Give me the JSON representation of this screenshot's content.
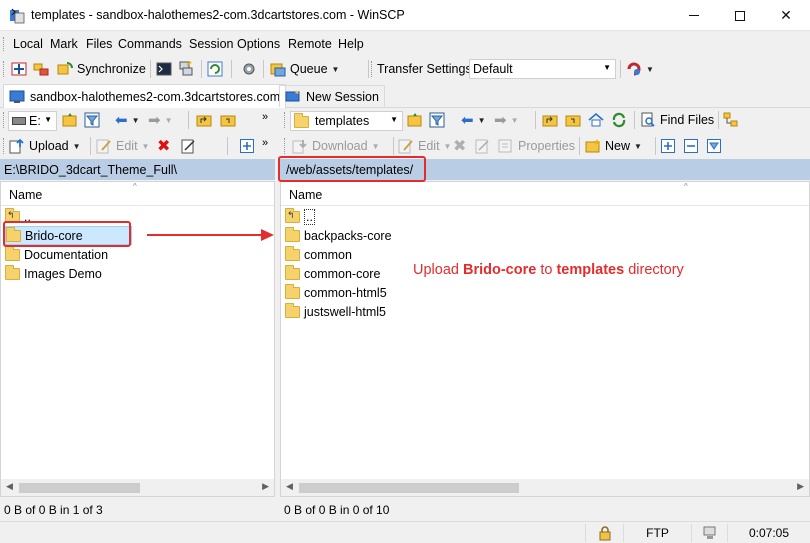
{
  "window": {
    "title": "templates - sandbox-halothemes2-com.3dcartstores.com - WinSCP"
  },
  "menu": [
    "Local",
    "Mark",
    "Files",
    "Commands",
    "Session",
    "Options",
    "Remote",
    "Help"
  ],
  "toolbar": {
    "synchronize_label": "Synchronize",
    "queue_label": "Queue",
    "transfer_settings_label": "Transfer Settings",
    "transfer_settings_value": "Default"
  },
  "tabs": {
    "session_label": "sandbox-halothemes2-com.3dcartstores.com",
    "new_session_label": "New Session"
  },
  "left": {
    "drive": "E:",
    "path": "E:\\BRIDO_3dcart_Theme_Full\\",
    "upload_label": "Upload",
    "edit_label": "Edit",
    "column_name": "Name",
    "parent": "..",
    "items": [
      "Brido-core",
      "Documentation",
      "Images Demo"
    ],
    "status": "0 B of 0 B in 1 of 3"
  },
  "right": {
    "folder": "templates",
    "path": "/web/assets/templates/",
    "find_files_label": "Find Files",
    "download_label": "Download",
    "edit_label": "Edit",
    "properties_label": "Properties",
    "new_label": "New",
    "column_name": "Name",
    "parent": "..",
    "items": [
      "backpacks-core",
      "common",
      "common-core",
      "common-html5",
      "justswell-html5"
    ],
    "status": "0 B of 0 B in 0 of 10"
  },
  "annotation": {
    "prefix": "Upload ",
    "bold1": "Brido-core",
    "middle": " to ",
    "bold2": "templates",
    "suffix": " directory",
    "color": "#e52c2c"
  },
  "statusbar": {
    "protocol": "FTP",
    "elapsed": "0:07:05"
  },
  "colors": {
    "path_bar": "#b9cde5",
    "selection": "#cce8ff",
    "highlight": "#e52c2c"
  }
}
